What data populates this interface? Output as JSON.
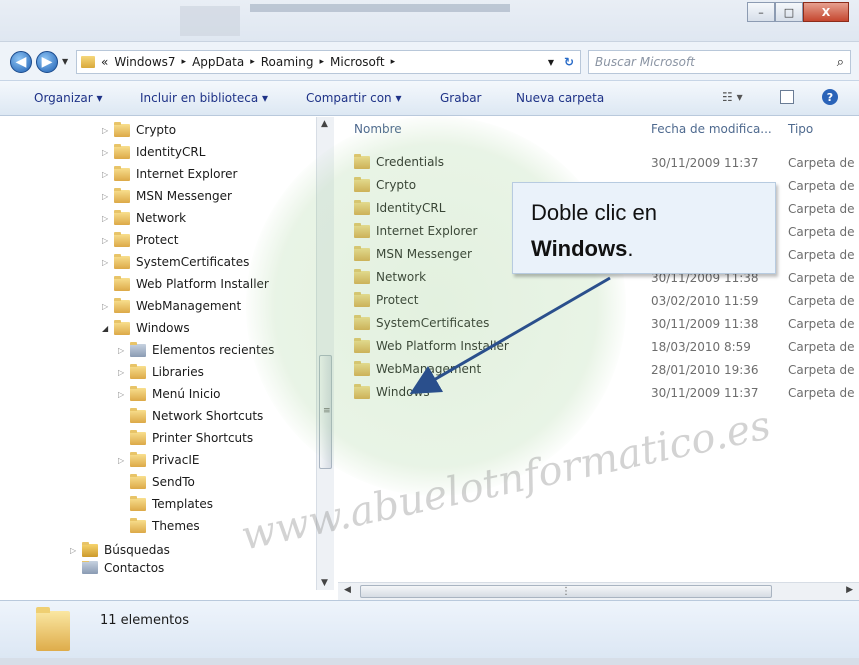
{
  "window": {
    "minimize_label": "–",
    "maximize_label": "□",
    "close_label": "X"
  },
  "address": {
    "overflow": "«",
    "crumbs": [
      "Windows7",
      "AppData",
      "Roaming",
      "Microsoft"
    ],
    "separator": "▸",
    "search_placeholder": "Buscar Microsoft"
  },
  "toolbar": {
    "organize": "Organizar ▾",
    "include_library": "Incluir en biblioteca ▾",
    "share_with": "Compartir con ▾",
    "burn": "Grabar",
    "new_folder": "Nueva carpeta"
  },
  "tree": [
    {
      "label": "Crypto",
      "indent": 1,
      "arrow": "▷"
    },
    {
      "label": "IdentityCRL",
      "indent": 1,
      "arrow": "▷"
    },
    {
      "label": "Internet Explorer",
      "indent": 1,
      "arrow": "▷"
    },
    {
      "label": "MSN Messenger",
      "indent": 1,
      "arrow": "▷"
    },
    {
      "label": "Network",
      "indent": 1,
      "arrow": "▷"
    },
    {
      "label": "Protect",
      "indent": 1,
      "arrow": "▷"
    },
    {
      "label": "SystemCertificates",
      "indent": 1,
      "arrow": "▷"
    },
    {
      "label": "Web Platform Installer",
      "indent": 1,
      "arrow": ""
    },
    {
      "label": "WebManagement",
      "indent": 1,
      "arrow": "▷"
    },
    {
      "label": "Windows",
      "indent": 1,
      "arrow": "◢"
    },
    {
      "label": "Elementos recientes",
      "indent": 2,
      "arrow": "▷"
    },
    {
      "label": "Libraries",
      "indent": 2,
      "arrow": "▷"
    },
    {
      "label": "Menú Inicio",
      "indent": 2,
      "arrow": "▷"
    },
    {
      "label": "Network Shortcuts",
      "indent": 2,
      "arrow": ""
    },
    {
      "label": "Printer Shortcuts",
      "indent": 2,
      "arrow": ""
    },
    {
      "label": "PrivacIE",
      "indent": 2,
      "arrow": "▷"
    },
    {
      "label": "SendTo",
      "indent": 2,
      "arrow": ""
    },
    {
      "label": "Templates",
      "indent": 2,
      "arrow": ""
    },
    {
      "label": "Themes",
      "indent": 2,
      "arrow": ""
    },
    {
      "label": "Búsquedas",
      "indent": 0,
      "arrow": "▷"
    },
    {
      "label": "Contactos",
      "indent": 0,
      "arrow": ""
    }
  ],
  "columns": {
    "name": "Nombre",
    "date": "Fecha de modifica...",
    "type": "Tipo"
  },
  "files": [
    {
      "name": "Credentials",
      "date": "30/11/2009 11:37",
      "type": "Carpeta de a"
    },
    {
      "name": "Crypto",
      "date": "",
      "type": "Carpeta de a"
    },
    {
      "name": "IdentityCRL",
      "date": "",
      "type": "Carpeta de a"
    },
    {
      "name": "Internet Explorer",
      "date": "",
      "type": "Carpeta de a"
    },
    {
      "name": "MSN Messenger",
      "date": "",
      "type": "Carpeta de a"
    },
    {
      "name": "Network",
      "date": "30/11/2009 11:38",
      "type": "Carpeta de a"
    },
    {
      "name": "Protect",
      "date": "03/02/2010 11:59",
      "type": "Carpeta de a"
    },
    {
      "name": "SystemCertificates",
      "date": "30/11/2009 11:38",
      "type": "Carpeta de a"
    },
    {
      "name": "Web Platform Installer",
      "date": "18/03/2010 8:59",
      "type": "Carpeta de a"
    },
    {
      "name": "WebManagement",
      "date": "28/01/2010 19:36",
      "type": "Carpeta de a"
    },
    {
      "name": "Windows",
      "date": "30/11/2009 11:37",
      "type": "Carpeta de a"
    }
  ],
  "status": {
    "count": "11 elementos"
  },
  "callout": {
    "line1": "Doble clic en",
    "line2_bold": "Windows",
    "line2_suffix": "."
  },
  "watermark": "www.abuelotnformatico.es",
  "colors": {
    "accent": "#1e3287",
    "arrow": "#2a4f8c"
  }
}
